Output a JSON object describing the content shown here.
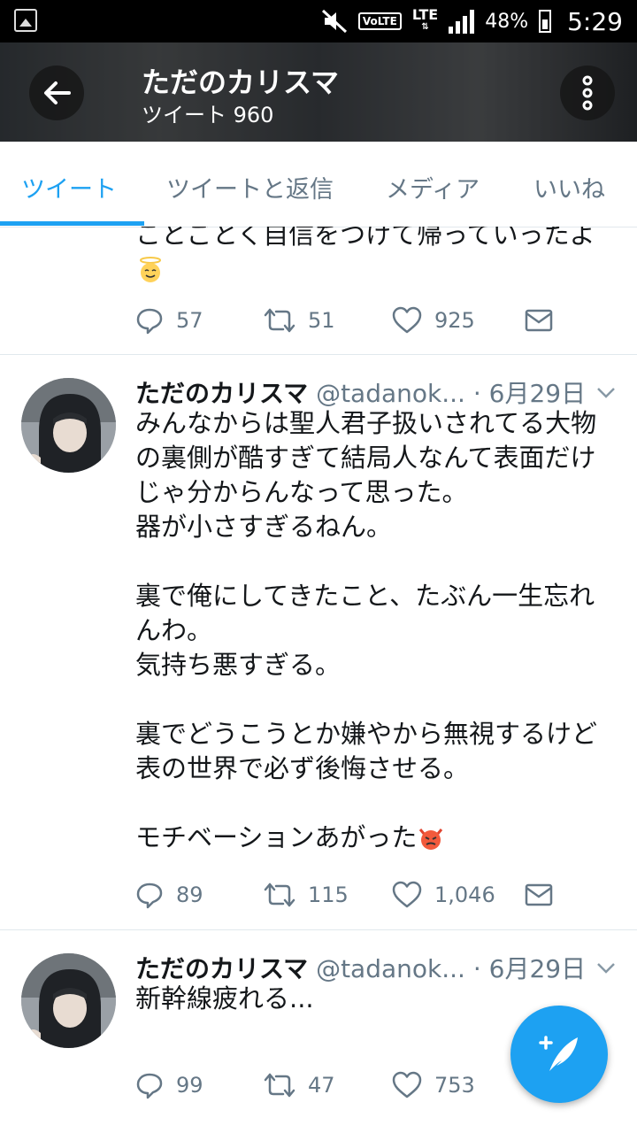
{
  "status_bar": {
    "battery": "48%",
    "time": "5:29",
    "network": "LTE",
    "volte": "VoLTE",
    "icons": [
      "gallery-icon",
      "mute-icon",
      "volte-icon",
      "lte-icon",
      "signal-icon",
      "battery-icon"
    ]
  },
  "header": {
    "title": "ただのカリスマ",
    "subtitle": "ツイート 960"
  },
  "tabs": [
    "ツイート",
    "ツイートと返信",
    "メディア",
    "いいね"
  ],
  "tweets": [
    {
      "partial_text": "ことごとく自信をつけて帰っていったよ",
      "emoji": "angel-face-emoji",
      "replies": "57",
      "retweets": "51",
      "likes": "925"
    },
    {
      "name": "ただのカリスマ",
      "handle": "@tadanok...",
      "date": "· 6月29日",
      "lines": [
        "みんなからは聖人君子扱いされてる大物",
        "の裏側が酷すぎて結局人なんて表面だけ",
        "じゃ分からんなって思った。",
        "器が小さすぎるねん。",
        "",
        "裏で俺にしてきたこと、たぶん一生忘れ",
        "んわ。",
        "気持ち悪すぎる。",
        "",
        "裏でどうこうとか嫌やから無視するけど",
        "表の世界で必ず後悔させる。",
        "",
        "モチベーションあがった"
      ],
      "emoji": "angry-devil-emoji",
      "replies": "89",
      "retweets": "115",
      "likes": "1,046"
    },
    {
      "name": "ただのカリスマ",
      "handle": "@tadanok...",
      "date": "· 6月29日",
      "text": "新幹線疲れる...",
      "replies": "99",
      "retweets": "47",
      "likes": "753"
    }
  ],
  "accent_color": "#1da1f2"
}
